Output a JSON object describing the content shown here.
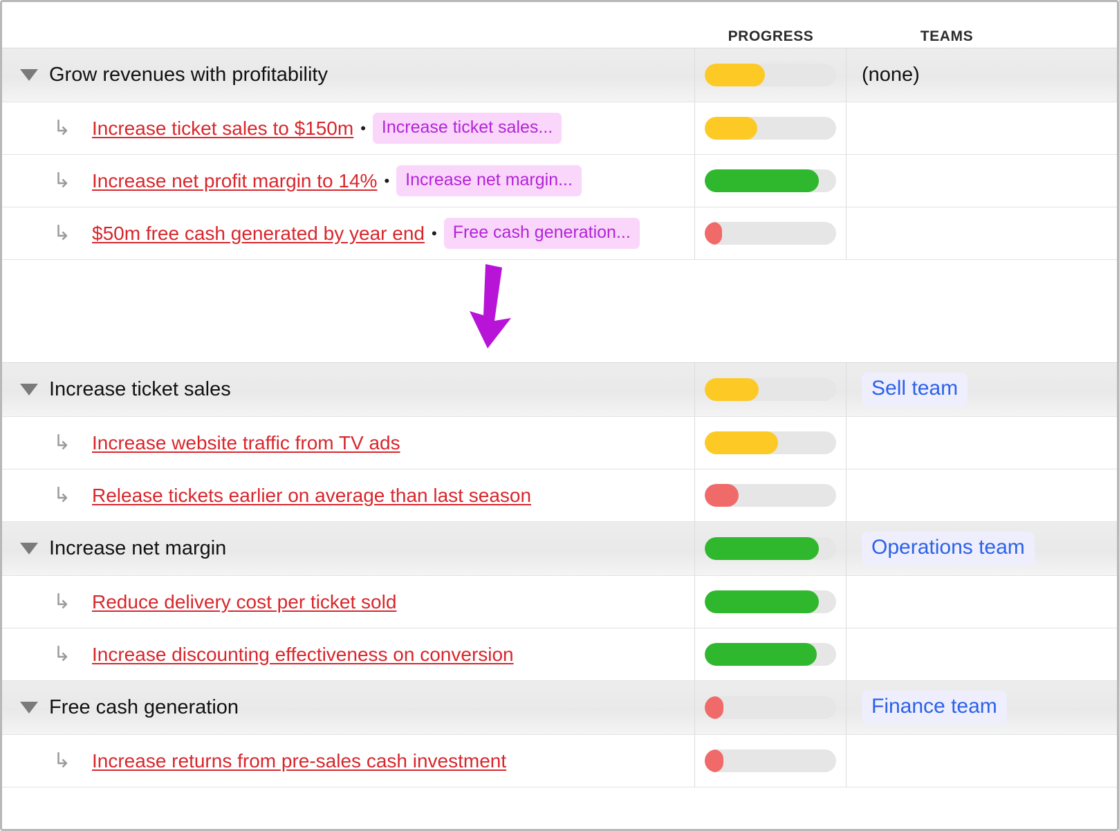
{
  "columns": {
    "progress_label": "PROGRESS",
    "teams_label": "TEAMS"
  },
  "colors": {
    "link": "#d8262c",
    "chip_bg": "#fad6fb",
    "chip_text": "#b324d8",
    "team_bg": "#eeeefc",
    "team_text": "#2b62e8",
    "bar_track": "#e6e6e6",
    "bar_yellow": "#fdc925",
    "bar_green": "#2fb82e",
    "bar_red": "#f06a6a",
    "group_row_bg": "#ececec",
    "arrow": "#b714d8"
  },
  "icons": {
    "caret": "caret-down-icon",
    "sub_arrow": "↳",
    "bullet": "•",
    "down_arrow": "down-arrow-annotation"
  },
  "upper_table": {
    "groups": [
      {
        "title": "Grow revenues with profitability",
        "progress": {
          "percent": 46,
          "color": "yellow"
        },
        "team": "(none)",
        "team_is_badge": false,
        "children": [
          {
            "link": "Increase ticket sales to $150m",
            "chip": "Increase ticket sales...",
            "progress": {
              "percent": 40,
              "color": "yellow"
            },
            "team": ""
          },
          {
            "link": "Increase net profit margin to 14%",
            "chip": "Increase net margin...",
            "progress": {
              "percent": 87,
              "color": "green"
            },
            "team": ""
          },
          {
            "link": "$50m free cash generated by year end",
            "chip": "Free cash generation...",
            "progress": {
              "percent": 13,
              "color": "red"
            },
            "team": ""
          }
        ]
      }
    ]
  },
  "lower_table": {
    "groups": [
      {
        "title": "Increase ticket sales",
        "progress": {
          "percent": 41,
          "color": "yellow"
        },
        "team": "Sell team",
        "team_is_badge": true,
        "children": [
          {
            "link": "Increase website traffic from TV ads",
            "chip": "",
            "progress": {
              "percent": 56,
              "color": "yellow"
            },
            "team": ""
          },
          {
            "link": "Release tickets earlier on average than last season",
            "chip": "",
            "progress": {
              "percent": 26,
              "color": "red"
            },
            "team": ""
          }
        ]
      },
      {
        "title": "Increase net margin",
        "progress": {
          "percent": 87,
          "color": "green"
        },
        "team": "Operations team",
        "team_is_badge": true,
        "children": [
          {
            "link": "Reduce delivery cost per ticket sold",
            "chip": "",
            "progress": {
              "percent": 87,
              "color": "green"
            },
            "team": ""
          },
          {
            "link": "Increase discounting effectiveness on conversion",
            "chip": "",
            "progress": {
              "percent": 85,
              "color": "green"
            },
            "team": ""
          }
        ]
      },
      {
        "title": "Free cash generation",
        "progress": {
          "percent": 14,
          "color": "red"
        },
        "team": "Finance team",
        "team_is_badge": true,
        "children": [
          {
            "link": "Increase returns from pre-sales cash investment",
            "chip": "",
            "progress": {
              "percent": 14,
              "color": "red"
            },
            "team": ""
          }
        ]
      }
    ]
  }
}
